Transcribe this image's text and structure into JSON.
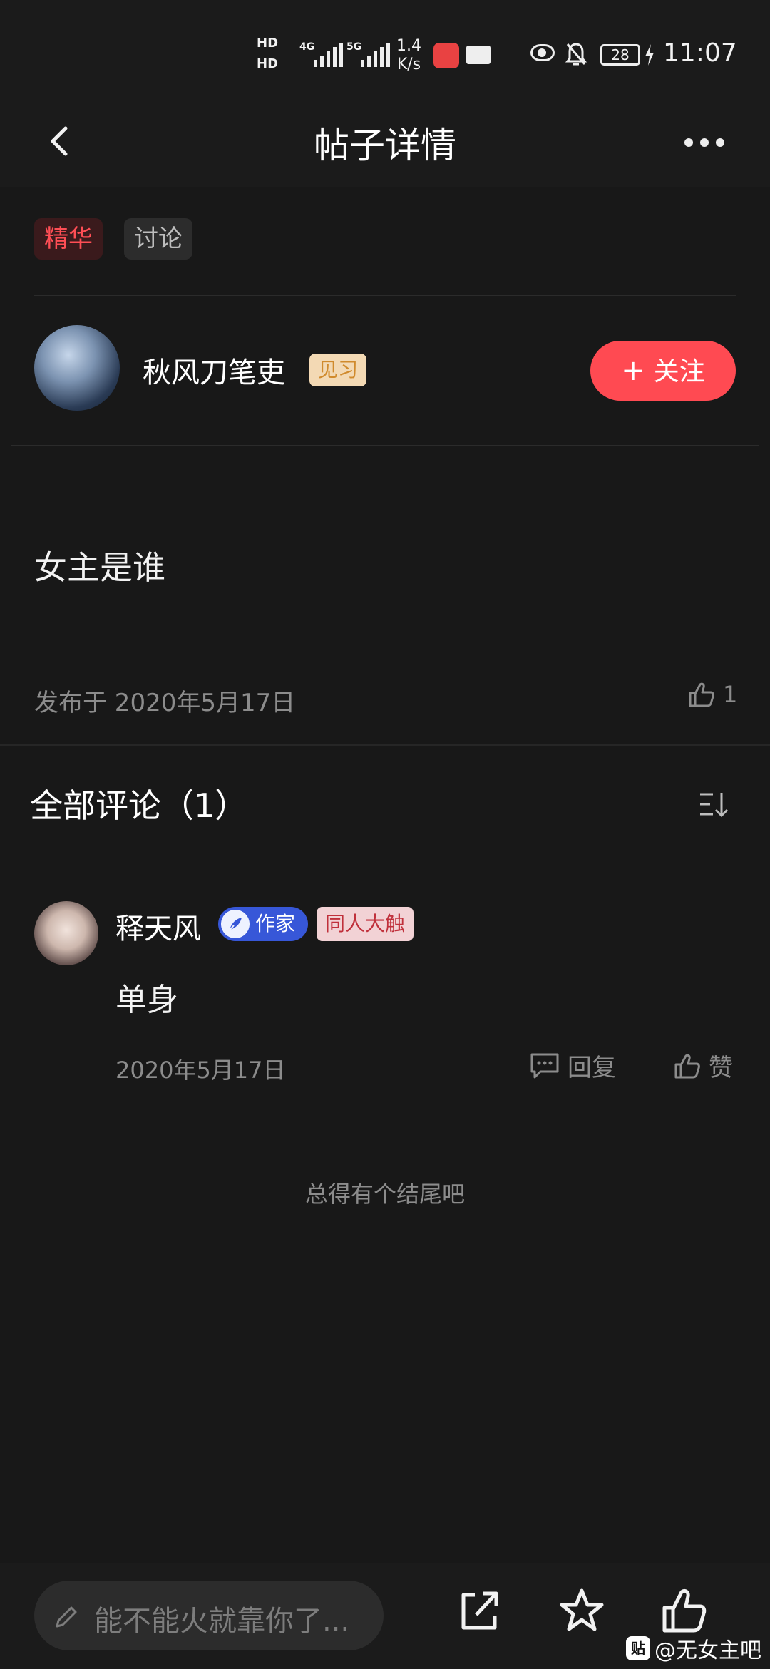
{
  "status_bar": {
    "hd1": "HD",
    "hd2": "HD",
    "net1": "4G",
    "net2": "5G",
    "speed_value": "1.4",
    "speed_unit": "K/s",
    "battery": "28",
    "time": "11:07"
  },
  "nav": {
    "title": "帖子详情"
  },
  "tags": {
    "featured": "精华",
    "discussion": "讨论"
  },
  "author": {
    "name": "秋风刀笔吏",
    "level": "见习",
    "follow_label": "关注"
  },
  "post": {
    "text": "女主是谁",
    "date": "发布于 2020年5月17日",
    "likes": "1"
  },
  "comments": {
    "title": "全部评论（1）",
    "items": [
      {
        "name": "释天风",
        "badge_writer": "作家",
        "badge_fan": "同人大触",
        "text": "单身",
        "date": "2020年5月17日",
        "reply_label": "回复",
        "like_label": "赞"
      }
    ],
    "end_text": "总得有个结尾吧"
  },
  "bottom": {
    "input_placeholder": "能不能火就靠你了...",
    "watermark": "@无女主吧",
    "watermark_logo": "贴"
  },
  "colors": {
    "accent": "#ff4a52",
    "background": "#181818",
    "writer_badge": "#3757d8"
  }
}
